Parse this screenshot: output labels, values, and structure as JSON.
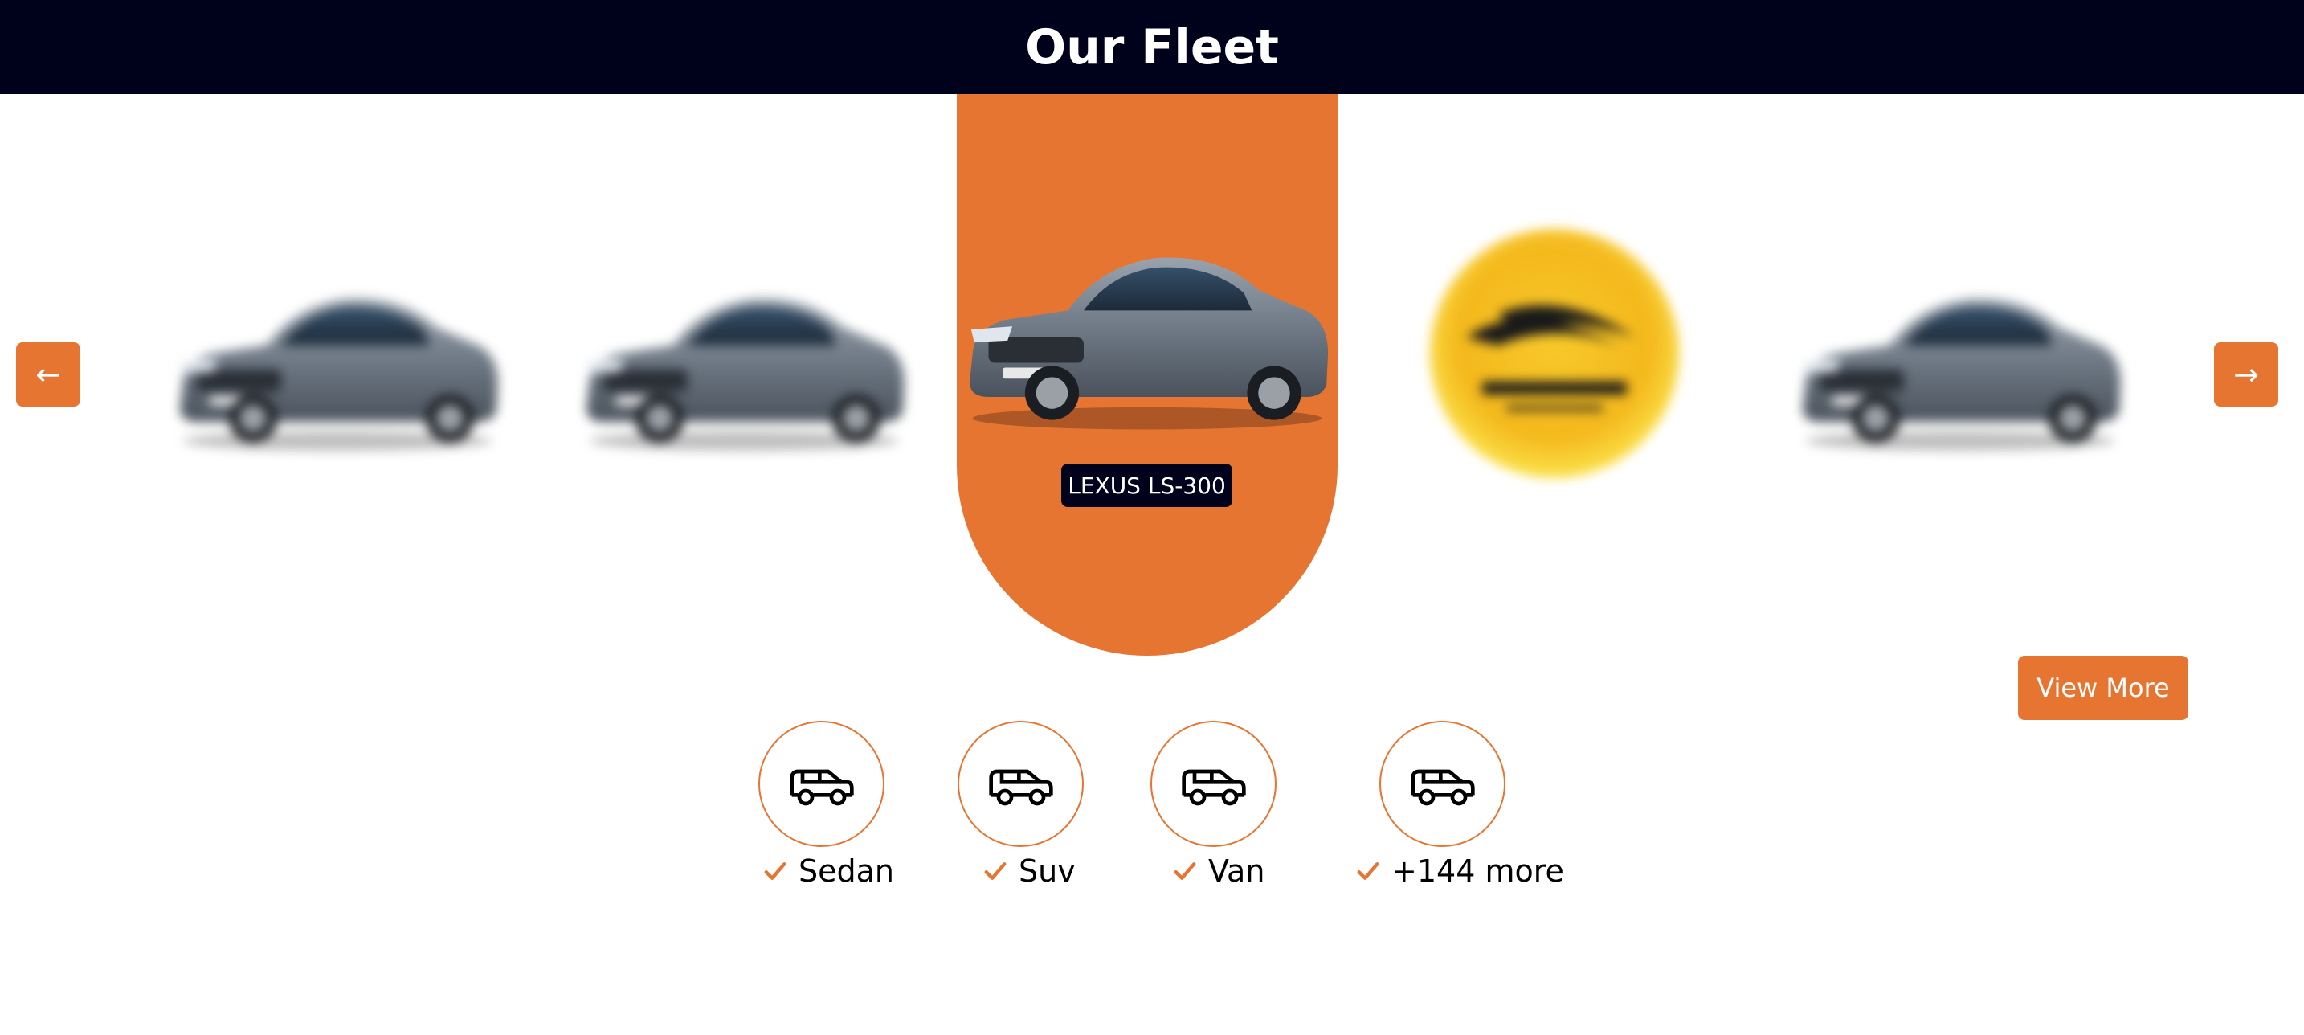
{
  "header": {
    "title": "Our Fleet"
  },
  "carousel": {
    "prev_label": "←",
    "next_label": "→",
    "featured_name": "LEXUS LS-300",
    "accent_color": "#e67532",
    "dark_color": "#00021c",
    "slides": [
      "car",
      "car",
      "featured-car",
      "logo",
      "car"
    ]
  },
  "view_more_label": "View More",
  "categories": [
    {
      "label": "Sedan",
      "icon": "car-icon"
    },
    {
      "label": "Suv",
      "icon": "car-icon"
    },
    {
      "label": "Van",
      "icon": "car-icon"
    },
    {
      "label": "+144 more",
      "icon": "car-icon"
    }
  ]
}
